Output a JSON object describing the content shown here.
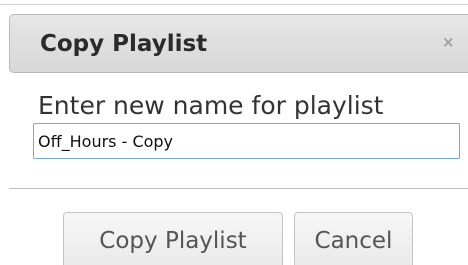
{
  "dialog": {
    "title": "Copy Playlist",
    "close_glyph": "×",
    "prompt": "Enter new name for playlist",
    "name_input": {
      "value": "Off_Hours - Copy"
    },
    "buttons": {
      "copy_label": "Copy Playlist",
      "cancel_label": "Cancel"
    }
  }
}
